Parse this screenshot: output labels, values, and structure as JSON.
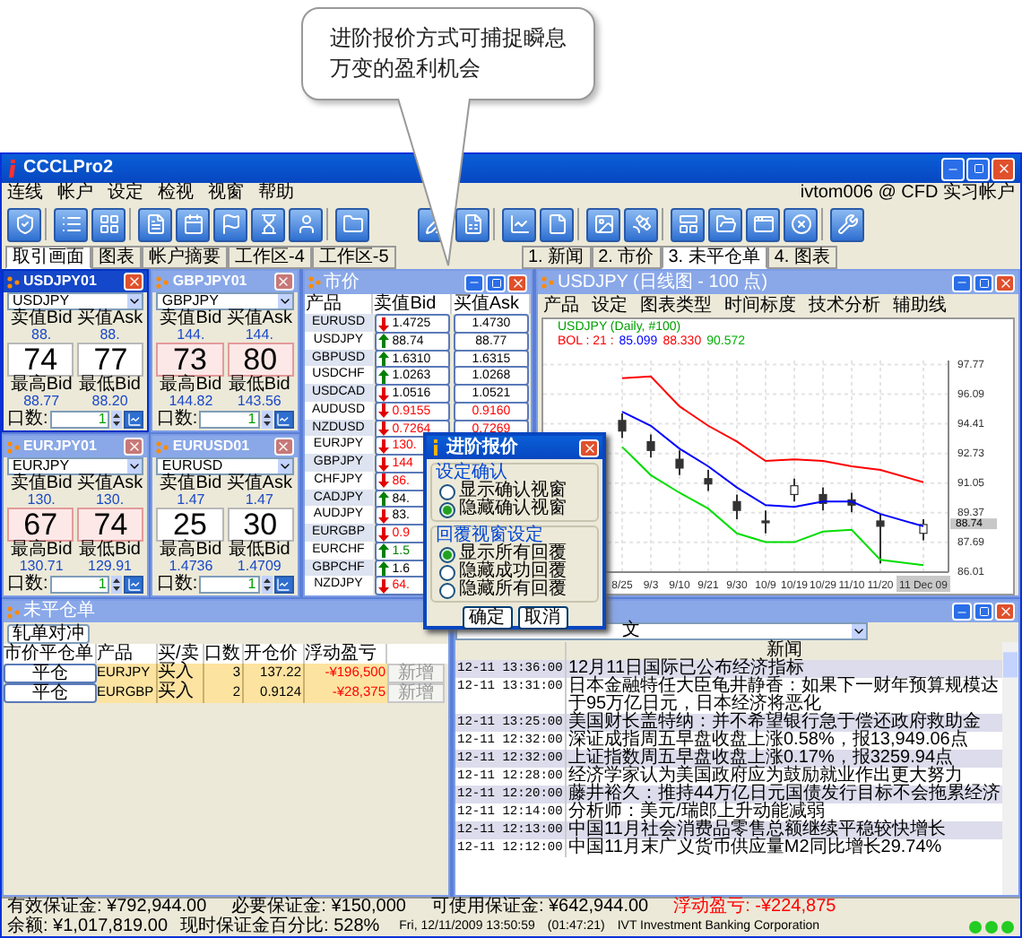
{
  "callout": {
    "lines": [
      "进阶报价方式可捕捉瞬息",
      "万变的盈利机会"
    ]
  },
  "window": {
    "title": "CCCLPro2",
    "menu": [
      "连线",
      "帐户",
      "设定",
      "检视",
      "视窗",
      "帮助"
    ],
    "account": "ivtom006 @ CFD 实习帐户",
    "tabs_left": [
      {
        "label": "取引画面",
        "selected": true
      },
      {
        "label": "图表",
        "selected": false
      },
      {
        "label": "帐户摘要",
        "selected": false
      },
      {
        "label": "工作区-4",
        "selected": false
      },
      {
        "label": "工作区-5",
        "selected": false
      }
    ],
    "tabs_right": [
      {
        "label": "1. 新闻",
        "selected": false
      },
      {
        "label": "2. 市价",
        "selected": false
      },
      {
        "label": "3. 未平仓单",
        "selected": true
      },
      {
        "label": "4. 图表",
        "selected": false
      }
    ]
  },
  "quote_panels": [
    {
      "title": "USDJPY01",
      "active": true,
      "symbol": "USDJPY",
      "bid_label": "卖值Bid",
      "ask_label": "买值Ask",
      "bid_prefix": "88.",
      "ask_prefix": "88.",
      "bid_pips": "74",
      "ask_pips": "77",
      "highlighted": false,
      "high_label": "最高Bid",
      "low_label": "最低Bid",
      "high": "88.77",
      "low": "88.20",
      "lots_label": "口数:",
      "lots": "1"
    },
    {
      "title": "GBPJPY01",
      "active": false,
      "symbol": "GBPJPY",
      "bid_label": "卖值Bid",
      "ask_label": "买值Ask",
      "bid_prefix": "144.",
      "ask_prefix": "144.",
      "bid_pips": "73",
      "ask_pips": "80",
      "highlighted": true,
      "high_label": "最高Bid",
      "low_label": "最低Bid",
      "high": "144.82",
      "low": "143.56",
      "lots_label": "口数:",
      "lots": "1"
    },
    {
      "title": "EURJPY01",
      "active": false,
      "symbol": "EURJPY",
      "bid_label": "卖值Bid",
      "ask_label": "买值Ask",
      "bid_prefix": "130.",
      "ask_prefix": "130.",
      "bid_pips": "67",
      "ask_pips": "74",
      "highlighted": true,
      "high_label": "最高Bid",
      "low_label": "最低Bid",
      "high": "130.71",
      "low": "129.91",
      "lots_label": "口数:",
      "lots": "1"
    },
    {
      "title": "EURUSD01",
      "active": false,
      "symbol": "EURUSD",
      "bid_label": "卖值Bid",
      "ask_label": "买值Ask",
      "bid_prefix": "1.47",
      "ask_prefix": "1.47",
      "bid_pips": "25",
      "ask_pips": "30",
      "highlighted": false,
      "high_label": "最高Bid",
      "low_label": "最低Bid",
      "high": "1.4736",
      "low": "1.4709",
      "lots_label": "口数:",
      "lots": "1"
    }
  ],
  "market": {
    "title": "市价",
    "columns": [
      "产品",
      "卖值Bid",
      "买值Ask"
    ],
    "rows": [
      {
        "product": "EURUSD",
        "rising": false,
        "bid": "1.4725",
        "ask": "1.4730",
        "color": "#000000"
      },
      {
        "product": "USDJPY",
        "rising": true,
        "bid": "88.74",
        "ask": "88.77",
        "color": "#000000"
      },
      {
        "product": "GBPUSD",
        "rising": true,
        "bid": "1.6310",
        "ask": "1.6315",
        "color": "#000000"
      },
      {
        "product": "USDCHF",
        "rising": true,
        "bid": "1.0263",
        "ask": "1.0268",
        "color": "#000000"
      },
      {
        "product": "USDCAD",
        "rising": false,
        "bid": "1.0516",
        "ask": "1.0521",
        "color": "#000000"
      },
      {
        "product": "AUDUSD",
        "rising": false,
        "bid": "0.9155",
        "ask": "0.9160",
        "color": "#ff0000"
      },
      {
        "product": "NZDUSD",
        "rising": false,
        "bid": "0.7264",
        "ask": "0.7269",
        "color": "#ff0000"
      },
      {
        "product": "EURJPY",
        "rising": false,
        "bid": "130.",
        "color": "#ff0000"
      },
      {
        "product": "GBPJPY",
        "rising": false,
        "bid": "144",
        "color": "#ff0000"
      },
      {
        "product": "CHFJPY",
        "rising": false,
        "bid": "86.",
        "color": "#ff0000"
      },
      {
        "product": "CADJPY",
        "rising": true,
        "bid": "84.",
        "color": "#000000"
      },
      {
        "product": "AUDJPY",
        "rising": false,
        "bid": "83.",
        "color": "#000000"
      },
      {
        "product": "EURGBP",
        "rising": false,
        "bid": "0.9",
        "color": "#ff0000"
      },
      {
        "product": "EURCHF",
        "rising": true,
        "bid": "1.5",
        "color": "#008000"
      },
      {
        "product": "GBPCHF",
        "rising": true,
        "bid": "1.6",
        "color": "#000000"
      },
      {
        "product": "NZDJPY",
        "rising": false,
        "bid": "64.",
        "color": "#ff0000"
      }
    ]
  },
  "chart": {
    "title": "USDJPY (日线图 - 100 点)",
    "menu": [
      "产品",
      "设定",
      "图表类型",
      "时间标度",
      "技术分析",
      "辅助线"
    ],
    "legend": "USDJPY (Daily, #100)",
    "bol_label": "BOL : 21 :",
    "bol_values": [
      {
        "text": "85.099",
        "color": "#0000ff"
      },
      {
        "text": "88.330",
        "color": "#ff0000"
      },
      {
        "text": "90.572",
        "color": "#00b000"
      }
    ],
    "price_marker": "88.74",
    "chart_data": {
      "type": "candlestick",
      "grid": true,
      "categories": [
        "8/25",
        "9/3",
        "9/10",
        "9/21",
        "9/30",
        "10/9",
        "10/19",
        "10/29",
        "11/10",
        "11/20",
        "11 Dec 09"
      ],
      "ylim": [
        86.0,
        98.0
      ],
      "yticks": [
        86.01,
        87.69,
        89.37,
        91.05,
        92.73,
        94.41,
        96.09,
        97.77
      ],
      "ohlc": [
        [
          94.6,
          95.0,
          93.6,
          94.0
        ],
        [
          93.4,
          93.8,
          92.5,
          92.9
        ],
        [
          92.4,
          92.9,
          91.5,
          91.9
        ],
        [
          91.3,
          91.8,
          90.6,
          91.0
        ],
        [
          90.0,
          90.4,
          89.0,
          89.5
        ],
        [
          88.9,
          89.5,
          88.2,
          88.8
        ],
        [
          90.4,
          91.3,
          90.0,
          90.9
        ],
        [
          90.4,
          90.8,
          89.5,
          89.9
        ],
        [
          90.1,
          90.5,
          89.4,
          89.8
        ],
        [
          88.9,
          89.3,
          86.5,
          88.6
        ],
        [
          88.2,
          89.0,
          87.8,
          88.7
        ]
      ],
      "series": [
        {
          "type": "line",
          "color": "#ff0000",
          "values": [
            97.0,
            97.1,
            95.4,
            94.3,
            93.4,
            92.3,
            92.4,
            92.3,
            92.0,
            91.8,
            91.1
          ]
        },
        {
          "type": "line",
          "color": "#0000ff",
          "values": [
            95.1,
            94.3,
            93.0,
            92.0,
            90.8,
            89.8,
            89.7,
            90.0,
            90.0,
            89.3,
            88.6
          ]
        },
        {
          "type": "line",
          "color": "#00dd00",
          "values": [
            93.1,
            91.5,
            90.5,
            89.6,
            88.2,
            87.7,
            87.7,
            88.3,
            88.4,
            86.7,
            86.4
          ]
        }
      ]
    }
  },
  "dialog": {
    "title": "进阶报价",
    "groups": [
      {
        "label": "设定确认",
        "options": [
          {
            "label": "显示确认视窗",
            "selected": false
          },
          {
            "label": "隐藏确认视窗",
            "selected": true
          }
        ]
      },
      {
        "label": "回覆视窗设定",
        "options": [
          {
            "label": "显示所有回覆",
            "selected": true
          },
          {
            "label": "隐藏成功回覆",
            "selected": false
          },
          {
            "label": "隐藏所有回覆",
            "selected": false
          }
        ]
      }
    ],
    "buttons": [
      "确定",
      "取消"
    ]
  },
  "positions": {
    "title": "未平仓单",
    "hedge_button": "轧单对冲",
    "columns": [
      "市价平仓单",
      "产品",
      "买/卖",
      "口数",
      "开仓价",
      "浮动盈亏"
    ],
    "rows": [
      {
        "close_button": "平仓",
        "product": "EURJPY",
        "side": "买入",
        "lots": "3",
        "open_price": "137.22",
        "pnl": "-¥196,500",
        "add_button": "新增"
      },
      {
        "close_button": "平仓",
        "product": "EURGBP",
        "side": "买入",
        "lots": "2",
        "open_price": "0.9124",
        "pnl": "-¥28,375",
        "add_button": "新增"
      }
    ]
  },
  "news": {
    "language": "文",
    "header": "新闻",
    "rows": [
      {
        "time": "12-11 13:36:00",
        "text": "12月11日国际已公布经济指标"
      },
      {
        "time": "12-11 13:31:00",
        "text": "日本金融特任大臣龟井静香：如果下一财年预算规模达于95万亿日元，日本经济将恶化"
      },
      {
        "time": "12-11 13:25:00",
        "text": "美国财长盖特纳：并不希望银行急于偿还政府救助金"
      },
      {
        "time": "12-11 12:32:00",
        "text": "深证成指周五早盘收盘上涨0.58%，报13,949.06点"
      },
      {
        "time": "12-11 12:32:00",
        "text": "上证指数周五早盘收盘上涨0.17%，报3259.94点"
      },
      {
        "time": "12-11 12:28:00",
        "text": "经济学家认为美国政府应为鼓励就业作出更大努力"
      },
      {
        "time": "12-11 12:20:00",
        "text": "藤井裕久：推持44万亿日元国债发行目标不会拖累经济"
      },
      {
        "time": "12-11 12:14:00",
        "text": "分析师：美元/瑞郎上升动能减弱"
      },
      {
        "time": "12-11 12:13:00",
        "text": "中国11月社会消费品零售总额继续平稳较快增长"
      },
      {
        "time": "12-11 12:12:00",
        "text": "中国11月末广义货币供应量M2同比增长29.74%"
      }
    ]
  },
  "status": {
    "row1": [
      {
        "text": "有效保证金: ¥792,944.00",
        "alert": false
      },
      {
        "text": "必要保证金: ¥150,000",
        "alert": false
      },
      {
        "text": "可使用保证金: ¥642,944.00",
        "alert": false
      },
      {
        "text": "浮动盈亏: -¥224,875",
        "alert": true
      }
    ],
    "balance": "余额: ¥1,017,819.00",
    "margin_ratio": "现时保证金百分比: 528%",
    "datetime": "Fri, 12/11/2009 13:50:59",
    "elapsed": "(01:47:21)",
    "company": "IVT Investment Banking Corporation"
  }
}
